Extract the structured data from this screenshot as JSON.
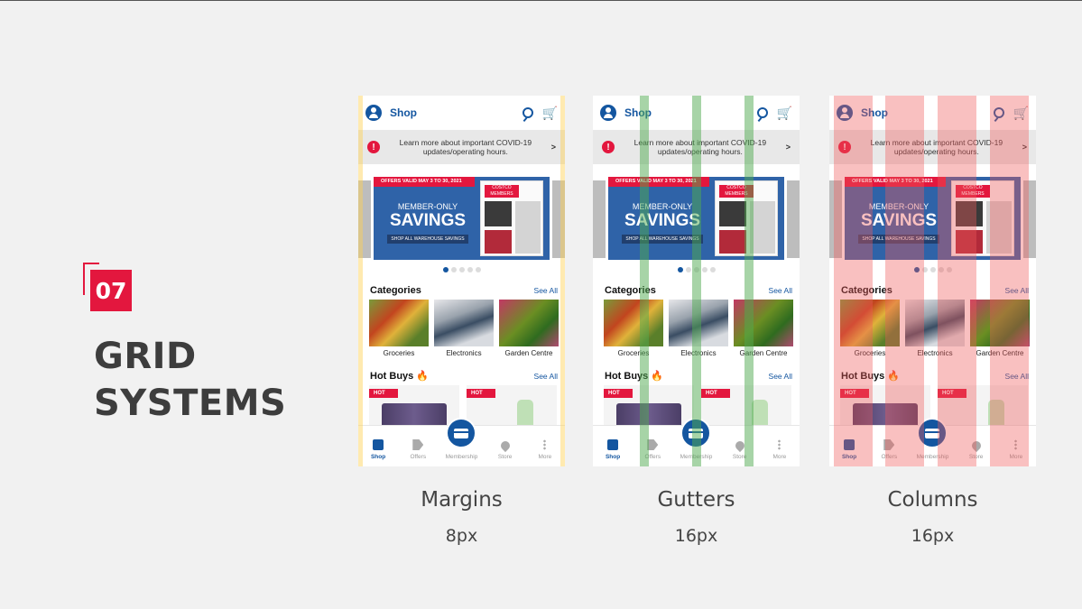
{
  "section": {
    "number": "07",
    "title_line1": "GRID",
    "title_line2": "SYSTEMS"
  },
  "phone": {
    "header_title": "Shop",
    "alert_text": "Learn more about important COVID-19 updates/operating hours.",
    "alert_icon": "!",
    "alert_chevron": ">",
    "banner": {
      "offer_strip": "OFFERS VALID MAY 3 TO 30, 2021",
      "member_only": "MEMBER-ONLY",
      "savings": "SAVINGS",
      "shop_all": "SHOP ALL WAREHOUSE SAVINGS",
      "flyer_top": "COSTCO MEMBERS ONLY"
    },
    "carousel_active_index": 0,
    "categories_title": "Categories",
    "categories_link": "See All",
    "categories": [
      "Groceries",
      "Electronics",
      "Garden Centre"
    ],
    "hot_buys_title": "Hot Buys",
    "hot_buys_link": "See All",
    "hot_badge": "HOT",
    "nav": [
      "Shop",
      "Offers",
      "Membership",
      "Store",
      "More"
    ]
  },
  "captions": [
    {
      "title": "Margins",
      "value": "8px"
    },
    {
      "title": "Gutters",
      "value": "16px"
    },
    {
      "title": "Columns",
      "value": "16px"
    }
  ],
  "colors": {
    "accent": "#e3173e",
    "brand_blue": "#1456a0",
    "margin_overlay": "#ffd050",
    "gutter_overlay": "#50aa50",
    "column_overlay": "#f05a5a"
  }
}
